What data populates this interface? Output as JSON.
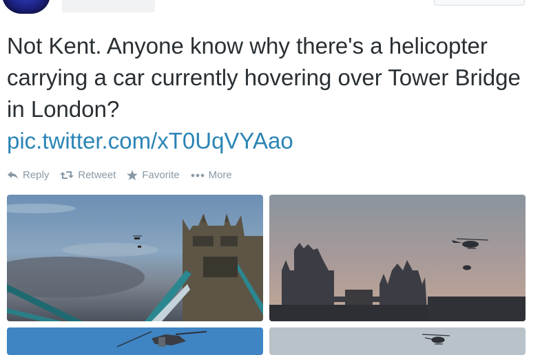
{
  "tweet": {
    "text": "Not Kent. Anyone know why there's a helicopter carrying a car currently hovering over Tower Bridge in London?",
    "link": "pic.twitter.com/xT0UqVYAao"
  },
  "actions": [
    {
      "label": "Reply",
      "icon": "reply-icon"
    },
    {
      "label": "Retweet",
      "icon": "retweet-icon"
    },
    {
      "label": "Favorite",
      "icon": "star-icon"
    },
    {
      "label": "More",
      "icon": "more-dots-icon"
    }
  ],
  "colors": {
    "link": "#2a84b5",
    "text": "#292f33",
    "action": "#8899a6"
  }
}
